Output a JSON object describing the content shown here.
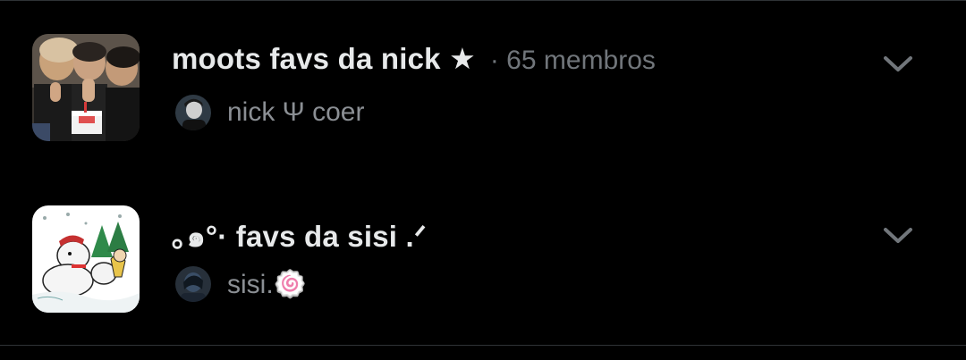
{
  "lists": [
    {
      "name": "moots favs da nick ★",
      "member_count": "· 65 membros",
      "owner_name": "nick Ψ coer",
      "thumbnail_icon": "group-photo-thumbnail",
      "expand_icon": "chevron-down-icon"
    },
    {
      "name": "｡๑°· favs da sisi .ᐟ",
      "member_count": "",
      "owner_name": "sisi.🍥",
      "thumbnail_icon": "snoopy-cartoon-thumbnail",
      "expand_icon": "chevron-down-icon"
    }
  ],
  "colors": {
    "background": "#000000",
    "primary_text": "#e7e9ea",
    "secondary_text": "#71767b",
    "divider": "#2f3336"
  }
}
